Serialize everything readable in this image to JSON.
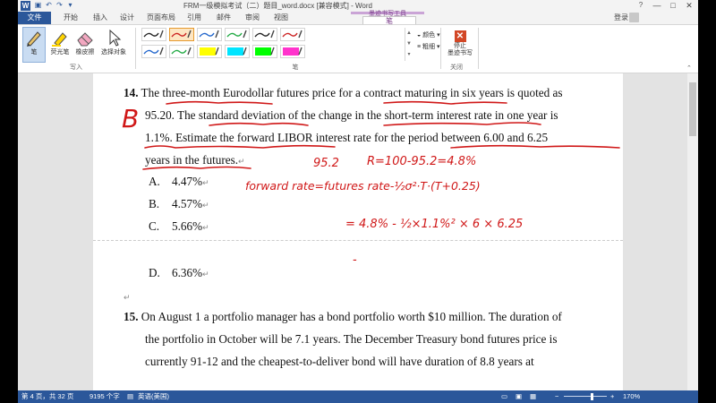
{
  "app": {
    "title": "FRM一级模拟考试（二）题目_word.docx [兼容模式] - Word",
    "help": "?",
    "minimize": "—",
    "maximize": "□",
    "close": "✕",
    "app_icon": "W",
    "login": "登录"
  },
  "tabs": {
    "file": "文件",
    "items": [
      "开始",
      "插入",
      "设计",
      "页面布局",
      "引用",
      "邮件",
      "审阅",
      "视图"
    ],
    "context_group": "墨迹书写工具",
    "active": "笔"
  },
  "ribbon": {
    "pen": "笔",
    "highlighter": "荧光笔",
    "eraser": "橡皮擦",
    "select": "选择对象",
    "group_write": "写入",
    "group_pen": "笔",
    "color": "颜色",
    "thickness": "粗细",
    "stop_line1": "停止",
    "stop_line2": "墨迹书写",
    "group_close": "关闭",
    "pen_swatches": [
      {
        "color": "#222222",
        "selected": false
      },
      {
        "color": "#cc2222",
        "selected": true
      },
      {
        "color": "#2266cc",
        "selected": false
      },
      {
        "color": "#22aa44",
        "selected": false
      },
      {
        "color": "#222222",
        "selected": false
      },
      {
        "color": "#cc2222",
        "selected": false
      },
      {
        "color": "#2266cc",
        "selected": false
      },
      {
        "color": "#22aa44",
        "selected": false
      },
      {
        "color": "#ffff00",
        "selected": false
      },
      {
        "color": "#00e5ff",
        "selected": false
      },
      {
        "color": "#00ff00",
        "selected": false
      },
      {
        "color": "#ff33cc",
        "selected": false
      }
    ]
  },
  "document": {
    "q14": {
      "number": "14.",
      "line1": "The three-month Eurodollar futures price for a contract maturing in six years is quoted as",
      "line2": "95.20. The standard deviation of the change in the short-term interest rate in one year is",
      "line3": "1.1%. Estimate the forward LIBOR interest rate for the period between 6.00 and 6.25",
      "line4": "years in the futures."
    },
    "options": [
      {
        "label": "A.",
        "text": "4.47%"
      },
      {
        "label": "B.",
        "text": "4.57%"
      },
      {
        "label": "C.",
        "text": "5.66%"
      },
      {
        "label": "D.",
        "text": "6.36%"
      }
    ],
    "q15": {
      "number": "15.",
      "line1": "On August 1 a portfolio manager has a bond portfolio worth $10 million. The duration of",
      "line2": "the portfolio in October will be 7.1 years. The December Treasury bond futures price is",
      "line3": "currently 91-12 and the cheapest-to-deliver bond will have duration of 8.8 years at"
    },
    "para_mark": "↵",
    "ink": {
      "answer": "B",
      "note1": "95.2",
      "note2": "R=100-95.2=4.8%",
      "note3": "forward rate=futures rate-½σ²·T·(T+0.25)",
      "note4": "= 4.8% - ½×1.1%² × 6 × 6.25",
      "note5": "-"
    }
  },
  "statusbar": {
    "page": "第 4 页，共 32 页",
    "words": "9195 个字",
    "language": "英语(美国)",
    "zoom": "170%",
    "zoom_level": 170
  }
}
